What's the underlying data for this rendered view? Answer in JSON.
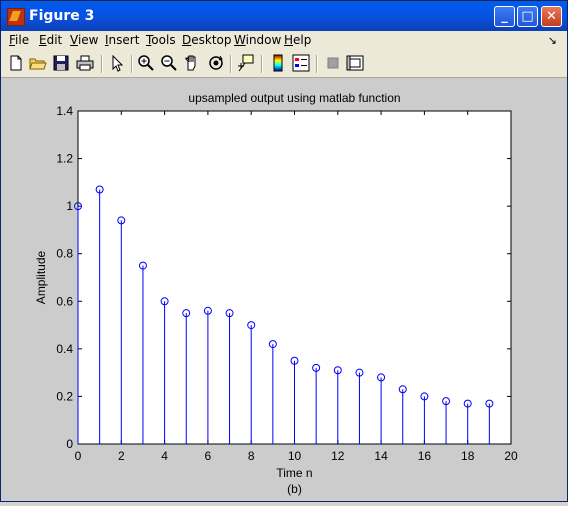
{
  "window": {
    "title": "Figure 3"
  },
  "menu": {
    "file": {
      "pre": "",
      "u": "F",
      "post": "ile"
    },
    "edit": {
      "pre": "",
      "u": "E",
      "post": "dit"
    },
    "view": {
      "pre": "",
      "u": "V",
      "post": "iew"
    },
    "insert": {
      "pre": "",
      "u": "I",
      "post": "nsert"
    },
    "tools": {
      "pre": "",
      "u": "T",
      "post": "ools"
    },
    "desktop": {
      "pre": "",
      "u": "D",
      "post": "esktop"
    },
    "window": {
      "pre": "",
      "u": "W",
      "post": "indow"
    },
    "help": {
      "pre": "",
      "u": "H",
      "post": "elp"
    },
    "dock_glyph": "↘"
  },
  "toolbar_icons": [
    "new-file-icon",
    "open-folder-icon",
    "save-icon",
    "print-icon",
    "select-arrow-icon",
    "zoom-in-icon",
    "zoom-out-icon",
    "pan-hand-icon",
    "rotate-3d-icon",
    "data-cursor-icon",
    "colorbar-icon",
    "legend-icon",
    "hide-plot-tools-icon",
    "show-plot-tools-icon"
  ],
  "chart_data": {
    "type": "stem",
    "title": "upsampled output using matlab function",
    "xlabel": "Time n",
    "ylabel": "Amplitude",
    "caption": "(b)",
    "xlim": [
      0,
      20
    ],
    "ylim": [
      0,
      1.4
    ],
    "xticks": [
      "0",
      "2",
      "4",
      "6",
      "8",
      "10",
      "12",
      "14",
      "16",
      "18",
      "20"
    ],
    "yticks": [
      "0",
      "0.2",
      "0.4",
      "0.6",
      "0.8",
      "1",
      "1.2",
      "1.4"
    ],
    "x": [
      0,
      1,
      2,
      3,
      4,
      5,
      6,
      7,
      8,
      9,
      10,
      11,
      12,
      13,
      14,
      15,
      16,
      17,
      18,
      19
    ],
    "y": [
      1.0,
      1.07,
      0.94,
      0.75,
      0.6,
      0.55,
      0.56,
      0.55,
      0.5,
      0.42,
      0.35,
      0.32,
      0.31,
      0.3,
      0.28,
      0.23,
      0.2,
      0.18,
      0.17,
      0.17
    ],
    "color": "#0000ff"
  }
}
